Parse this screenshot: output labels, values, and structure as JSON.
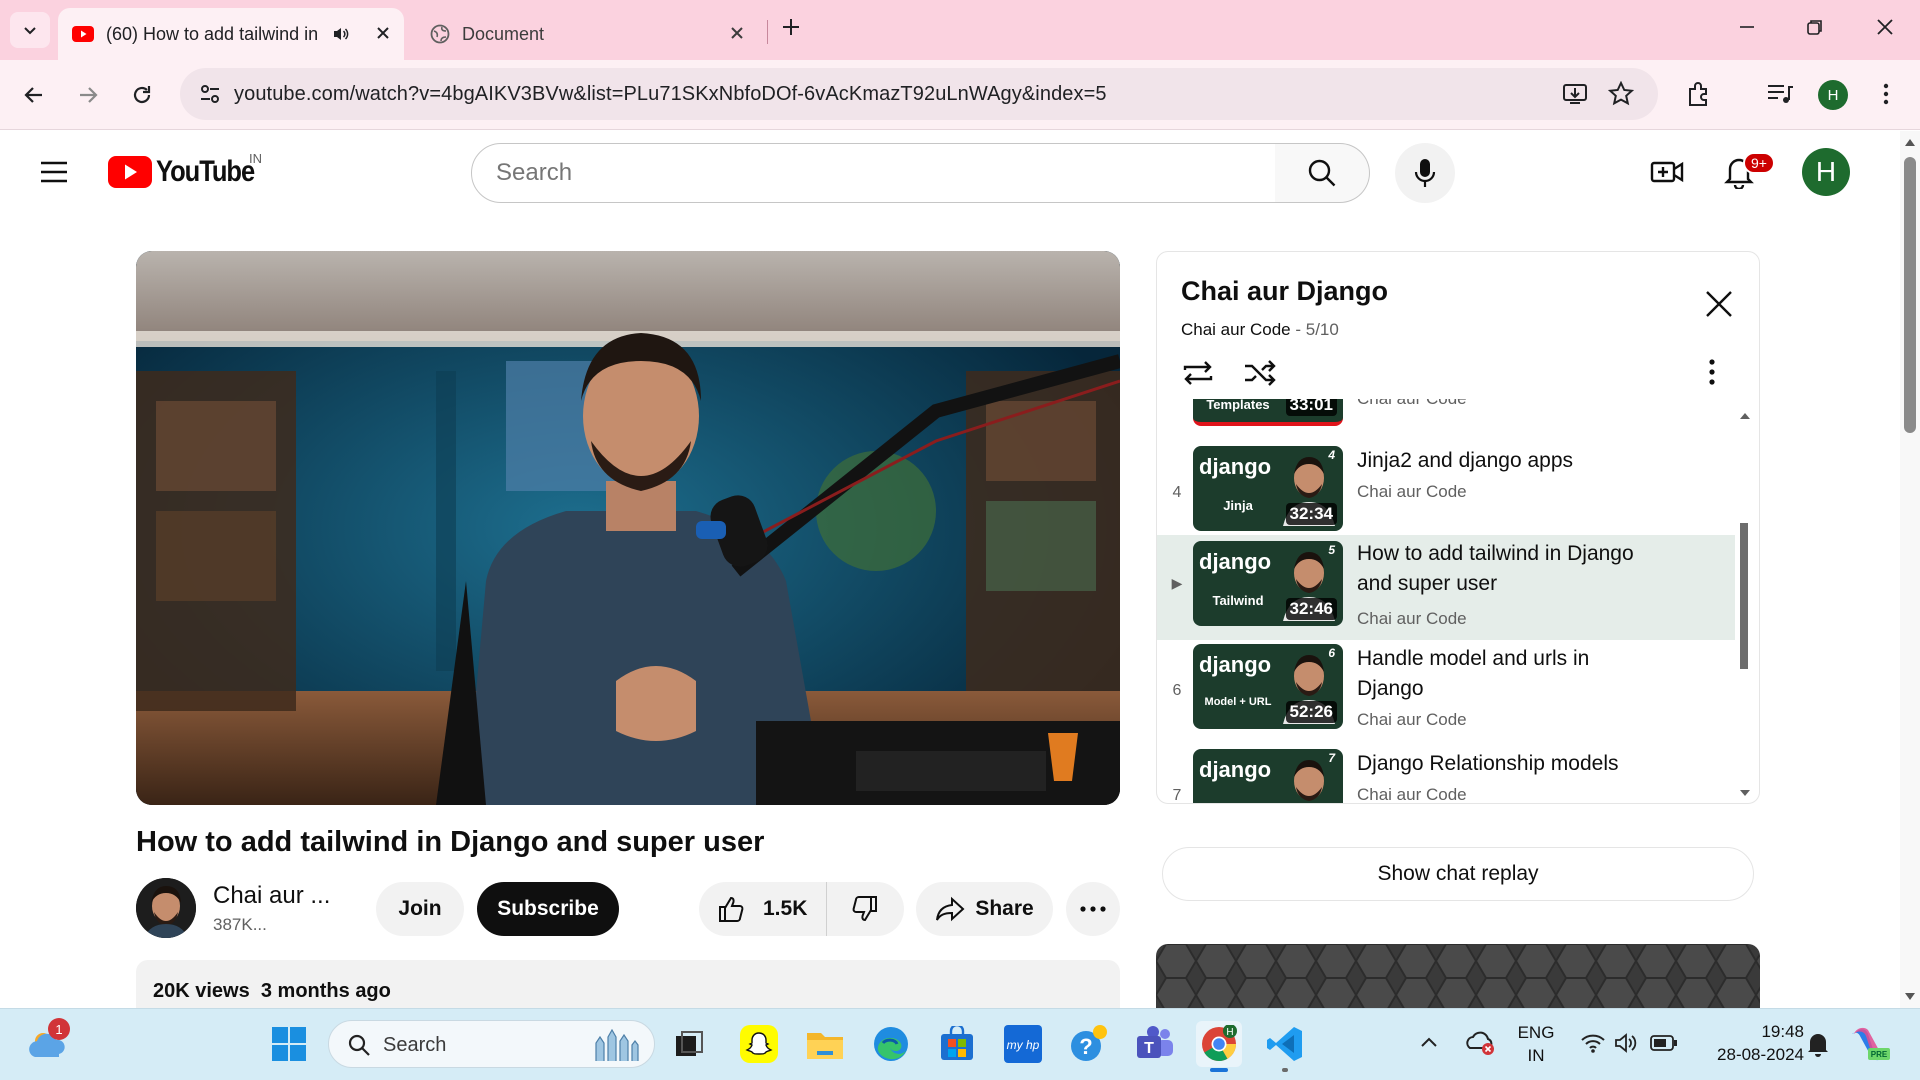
{
  "browser": {
    "tabs": [
      {
        "title": "(60) How to add tailwind in",
        "active": true
      },
      {
        "title": "Document",
        "active": false
      }
    ],
    "url": "youtube.com/watch?v=4bgAIKV3BVw&list=PLu71SKxNbfoDOf-6vAcKmazT92uLnWAgy&index=5",
    "profile_initial": "H"
  },
  "youtube": {
    "logo_text": "YouTube",
    "country_code": "IN",
    "search_placeholder": "Search",
    "notification_count": "9+",
    "avatar_initial": "H"
  },
  "video": {
    "title": "How to add tailwind in Django and super user",
    "channel": "Chai aur ...",
    "subscribers": "387K...",
    "join_label": "Join",
    "subscribe_label": "Subscribe",
    "likes": "1.5K",
    "share_label": "Share",
    "views": "20K views",
    "uploaded": "3 months ago"
  },
  "playlist": {
    "title": "Chai aur Django",
    "channel": "Chai aur Code",
    "position": "5/10",
    "items": [
      {
        "index": "",
        "thumb_brand": "",
        "thumb_topic": "Templates",
        "thumb_num": "",
        "duration": "33:01",
        "title": "",
        "channel": "Chai aur Code"
      },
      {
        "index": "4",
        "thumb_brand": "django",
        "thumb_topic": "Jinja",
        "thumb_num": "4",
        "duration": "32:34",
        "title": "Jinja2 and django apps",
        "channel": "Chai aur Code"
      },
      {
        "index": "▶",
        "thumb_brand": "django",
        "thumb_topic": "Tailwind",
        "thumb_num": "5",
        "duration": "32:46",
        "title": "How to add tailwind in Django and super user",
        "channel": "Chai aur Code"
      },
      {
        "index": "6",
        "thumb_brand": "django",
        "thumb_topic": "Model + URL",
        "thumb_num": "6",
        "duration": "52:26",
        "title": "Handle model and urls in Django",
        "channel": "Chai aur Code"
      },
      {
        "index": "7",
        "thumb_brand": "django",
        "thumb_topic": "",
        "thumb_num": "7",
        "duration": "",
        "title": "Django Relationship models",
        "channel": "Chai aur Code"
      }
    ]
  },
  "chat_replay_label": "Show chat replay",
  "taskbar": {
    "weather_badge": "1",
    "search_label": "Search",
    "language": "ENG",
    "region": "IN",
    "time": "19:48",
    "date": "28-08-2024"
  },
  "colors": {
    "tab_strip": "#fbd2df",
    "yt_red": "#ff0000",
    "current_item_bg": "#e5ede9",
    "taskbar": "#d5ecf6"
  }
}
